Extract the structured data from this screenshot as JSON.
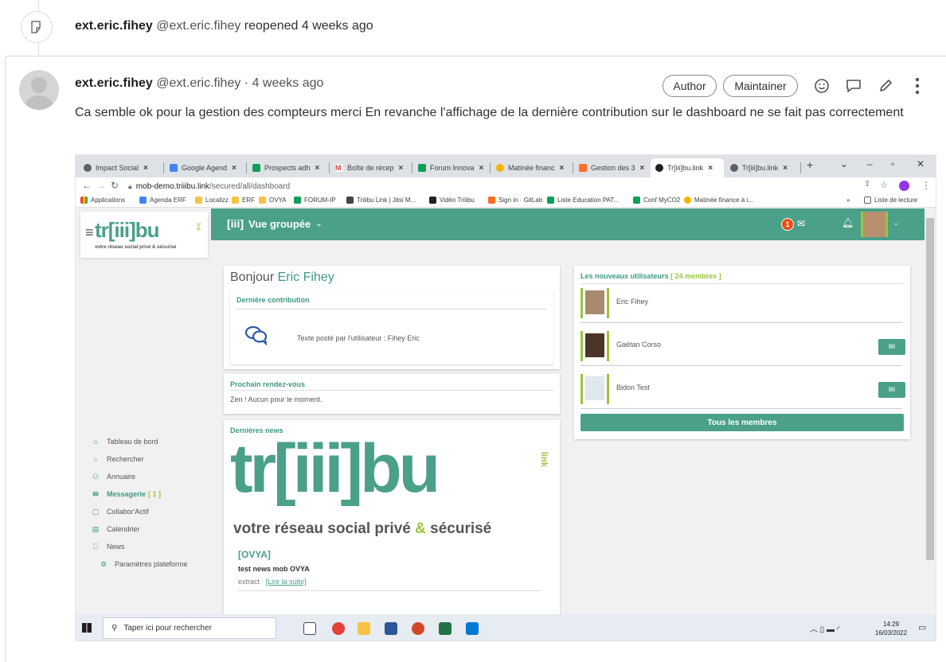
{
  "system_note": {
    "author": "ext.eric.fihey",
    "handle": "@ext.eric.fihey",
    "action": "reopened 4 weeks ago"
  },
  "note": {
    "author": "ext.eric.fihey",
    "handle": "@ext.eric.fihey",
    "separator": "·",
    "time": "4 weeks ago",
    "badges": [
      "Author",
      "Maintainer"
    ],
    "body": "Ca semble ok pour la gestion des compteurs merci En revanche l'affichage de la dernière contribution sur le dashboard ne se fait pas correctement",
    "actions": [
      "emoji-icon",
      "comment-icon",
      "edit-icon",
      "more-icon"
    ]
  },
  "screenshot": {
    "tabs": [
      {
        "label": "Impact Social",
        "color": "#5f6368"
      },
      {
        "label": "Google Agend",
        "color": "#4285f4"
      },
      {
        "label": "Prospects adh",
        "color": "#0f9d58"
      },
      {
        "label": "Boîte de récep",
        "color": "#ea4335"
      },
      {
        "label": "Forum Innova",
        "color": "#0f9d58"
      },
      {
        "label": "Matinée financ",
        "color": "#f4b400"
      },
      {
        "label": "Gestion des 3",
        "color": "#fc6d26"
      },
      {
        "label": "Tr[iii]bu.link",
        "color": "#202124"
      },
      {
        "label": "Tr[iii]bu.link",
        "color": "#5f6368"
      }
    ],
    "new_tab": "+",
    "url_host": "mob-demo.triiibu.link",
    "url_path": "/secured/all/dashboard",
    "bookmarks": [
      "Applications",
      "Agenda ERF",
      "Localizz",
      "ERF",
      "OVYA",
      "FORUM-IP",
      "Triiibu Link | Jitsi M...",
      "Vidéo Triiibu",
      "Sign in · GitLab",
      "Liste Education PAT...",
      "Conf MyCO2",
      "Matinée finance à i..."
    ],
    "reading_list": "Liste de lecture",
    "bookmarks_more": "»",
    "logo_text": "tr[iii]bu",
    "logo_link": "link",
    "logo_tagline": "votre réseau social privé & sécurisé",
    "sidebar": [
      {
        "label": "Tableau de bord",
        "icon": "home-icon"
      },
      {
        "label": "Rechercher",
        "icon": "search-icon"
      },
      {
        "label": "Annuaire",
        "icon": "people-icon"
      },
      {
        "label": "Messagerie",
        "count": "[ 1 ]",
        "icon": "mail-icon"
      },
      {
        "label": "Collabor'Actif",
        "icon": "collab-icon"
      },
      {
        "label": "Calendrier",
        "icon": "calendar-icon"
      },
      {
        "label": "News",
        "icon": "bookmark-icon"
      },
      {
        "label": "Paramètres plateforme",
        "icon": "settings-icon"
      }
    ],
    "topbar_brand": "[iii]",
    "topbar_title": "Vue groupée",
    "notif_count": "1",
    "greeting": "Bonjour",
    "greeting_name": "Eric Fihey",
    "last_contrib_title": "Dernière contribution",
    "last_contrib_text": "Texte posté par l'utilisateur : Fihey Eric",
    "next_meeting_title": "Prochain rendez-vous",
    "next_meeting_text": "Zen ! Aucun pour le moment.",
    "news_title": "Dernières news",
    "news_logo_text": "tr[iii]bu",
    "news_logo_link": "link",
    "news_tagline_1": "votre réseau social privé",
    "news_tagline_amp": "&",
    "news_tagline_2": "sécurisé",
    "news_tag": "[OVYA]",
    "news_item_title": "test news mob OVYA",
    "news_extract": "extract",
    "news_read_more": "[Lire la suite]",
    "new_users_title": "Les nouveaux utilisateurs",
    "new_users_count": "[ 24 membres ]",
    "users": [
      "Eric Fihey",
      "Gaëtan Corso",
      "Bidon Test"
    ],
    "all_members": "Tous les membres",
    "taskbar_search": "Taper ici pour rechercher",
    "clock_time": "14:29",
    "clock_date": "16/03/2022",
    "colors": {
      "accent": "#4aa088",
      "lime": "#9ac43c",
      "notif": "#e94e1b"
    }
  }
}
